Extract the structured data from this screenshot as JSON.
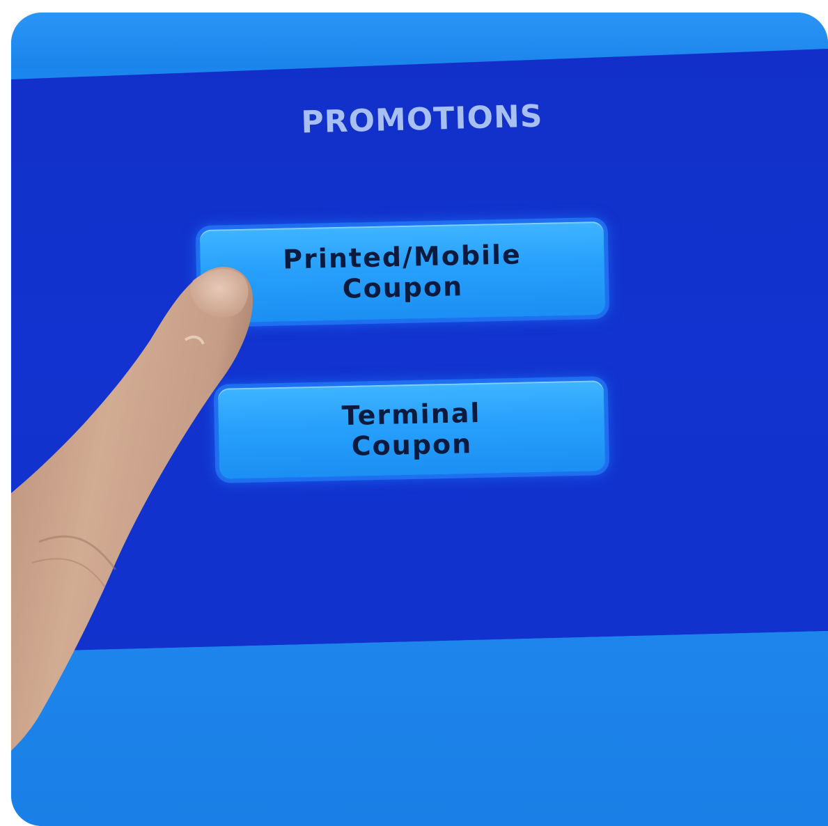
{
  "screen": {
    "title": "PROMOTIONS"
  },
  "buttons": {
    "printed_mobile": {
      "line1": "Printed/Mobile",
      "line2": "Coupon"
    },
    "terminal": {
      "line1": "Terminal",
      "line2": "Coupon"
    }
  },
  "colors": {
    "screen_bg": "#1232cc",
    "bezel": "#1b86ee",
    "button": "#27a0fb",
    "button_text": "#0c1a3d",
    "title_text": "#a8bff2"
  },
  "icons": {
    "pointing_finger": "hand-finger-icon"
  }
}
